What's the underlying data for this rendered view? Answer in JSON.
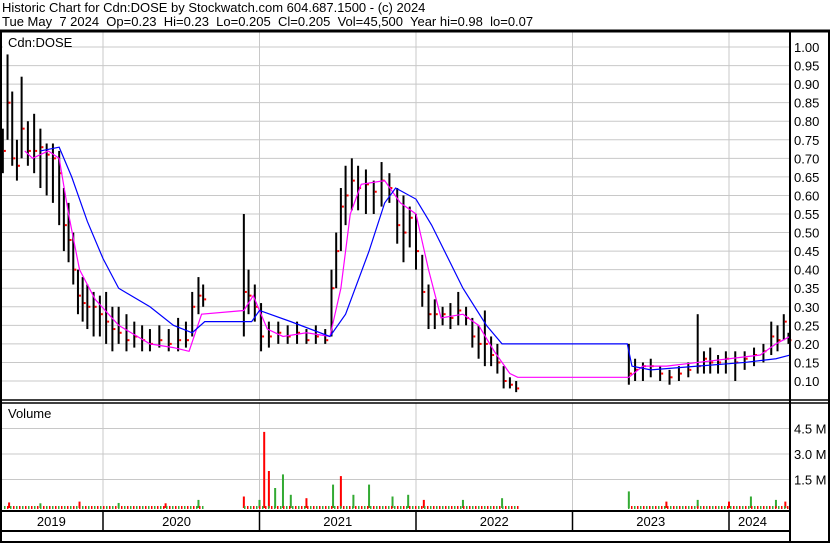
{
  "header": {
    "title": "Historic Chart for Cdn:DOSE by Stockwatch.com 604.687.1500 - (c) 2024",
    "quote": "Tue May  7 2024  Op=0.23  Hi=0.23  Lo=0.205  Cl=0.205  Vol=45,500  Year hi=0.98  lo=0.07"
  },
  "chart_data": {
    "type": "line",
    "title": "Cdn:DOSE",
    "volume_label": "Volume",
    "x_range": [
      2019.36,
      2024.39
    ],
    "ylim": [
      0.07,
      1.04
    ],
    "y_ticks": [
      "1.00",
      "0.95",
      "0.90",
      "0.85",
      "0.80",
      "0.75",
      "0.70",
      "0.65",
      "0.60",
      "0.55",
      "0.50",
      "0.45",
      "0.40",
      "0.35",
      "0.30",
      "0.25",
      "0.20",
      "0.15",
      "0.10"
    ],
    "y_tick_values": [
      1.0,
      0.95,
      0.9,
      0.85,
      0.8,
      0.75,
      0.7,
      0.65,
      0.6,
      0.55,
      0.5,
      0.45,
      0.4,
      0.35,
      0.3,
      0.25,
      0.2,
      0.15,
      0.1
    ],
    "volume_ticks": [
      "4.5 M",
      "3.0 M",
      "1.5 M"
    ],
    "volume_tick_values": [
      4.5,
      3.0,
      1.5
    ],
    "x_labels": [
      "2019",
      "2020",
      "2021",
      "2022",
      "2023",
      "2024"
    ],
    "x_label_positions": [
      2019.67,
      2020.47,
      2021.5,
      2022.5,
      2023.5,
      2024.15
    ],
    "year_boundaries": [
      2020,
      2021,
      2022,
      2023,
      2024
    ],
    "bars_hlc": [
      [
        2019.36,
        0.78,
        0.66,
        0.72
      ],
      [
        2019.39,
        0.98,
        0.75,
        0.85
      ],
      [
        2019.42,
        0.88,
        0.68,
        0.7
      ],
      [
        2019.45,
        0.75,
        0.64,
        0.68
      ],
      [
        2019.48,
        0.92,
        0.7,
        0.78
      ],
      [
        2019.52,
        0.8,
        0.68,
        0.72
      ],
      [
        2019.56,
        0.82,
        0.66,
        0.72
      ],
      [
        2019.6,
        0.78,
        0.62,
        0.73
      ],
      [
        2019.64,
        0.74,
        0.6,
        0.71
      ],
      [
        2019.68,
        0.74,
        0.58,
        0.7
      ],
      [
        2019.72,
        0.72,
        0.52,
        0.66
      ],
      [
        2019.75,
        0.62,
        0.45,
        0.52
      ],
      [
        2019.78,
        0.58,
        0.42,
        0.48
      ],
      [
        2019.81,
        0.5,
        0.36,
        0.4
      ],
      [
        2019.84,
        0.4,
        0.28,
        0.33
      ],
      [
        2019.87,
        0.38,
        0.26,
        0.31
      ],
      [
        2019.9,
        0.36,
        0.24,
        0.3
      ],
      [
        2019.94,
        0.34,
        0.22,
        0.3
      ],
      [
        2019.98,
        0.33,
        0.22,
        0.28
      ],
      [
        2020.02,
        0.34,
        0.2,
        0.26
      ],
      [
        2020.06,
        0.3,
        0.18,
        0.24
      ],
      [
        2020.1,
        0.3,
        0.2,
        0.23
      ],
      [
        2020.15,
        0.28,
        0.18,
        0.21
      ],
      [
        2020.2,
        0.26,
        0.19,
        0.22
      ],
      [
        2020.25,
        0.25,
        0.18,
        0.21
      ],
      [
        2020.3,
        0.24,
        0.18,
        0.2
      ],
      [
        2020.36,
        0.25,
        0.19,
        0.21
      ],
      [
        2020.42,
        0.24,
        0.18,
        0.2
      ],
      [
        2020.48,
        0.27,
        0.18,
        0.21
      ],
      [
        2020.53,
        0.26,
        0.19,
        0.21
      ],
      [
        2020.57,
        0.34,
        0.22,
        0.3
      ],
      [
        2020.61,
        0.38,
        0.28,
        0.33
      ],
      [
        2020.64,
        0.36,
        0.3,
        0.32
      ],
      [
        2020.9,
        0.55,
        0.22,
        0.34
      ],
      [
        2020.93,
        0.4,
        0.28,
        0.33
      ],
      [
        2020.97,
        0.36,
        0.26,
        0.3
      ],
      [
        2021.01,
        0.31,
        0.18,
        0.22
      ],
      [
        2021.06,
        0.26,
        0.19,
        0.22
      ],
      [
        2021.12,
        0.26,
        0.2,
        0.23
      ],
      [
        2021.18,
        0.25,
        0.2,
        0.22
      ],
      [
        2021.24,
        0.26,
        0.2,
        0.23
      ],
      [
        2021.3,
        0.24,
        0.2,
        0.21
      ],
      [
        2021.36,
        0.25,
        0.2,
        0.22
      ],
      [
        2021.42,
        0.24,
        0.2,
        0.21
      ],
      [
        2021.46,
        0.4,
        0.22,
        0.35
      ],
      [
        2021.49,
        0.5,
        0.35,
        0.45
      ],
      [
        2021.52,
        0.62,
        0.45,
        0.57
      ],
      [
        2021.55,
        0.68,
        0.52,
        0.6
      ],
      [
        2021.59,
        0.7,
        0.56,
        0.64
      ],
      [
        2021.63,
        0.68,
        0.56,
        0.62
      ],
      [
        2021.68,
        0.67,
        0.55,
        0.63
      ],
      [
        2021.73,
        0.64,
        0.55,
        0.61
      ],
      [
        2021.78,
        0.69,
        0.57,
        0.64
      ],
      [
        2021.83,
        0.66,
        0.58,
        0.62
      ],
      [
        2021.88,
        0.62,
        0.47,
        0.52
      ],
      [
        2021.92,
        0.6,
        0.42,
        0.5
      ],
      [
        2021.96,
        0.57,
        0.46,
        0.54
      ],
      [
        2022.0,
        0.55,
        0.4,
        0.45
      ],
      [
        2022.04,
        0.44,
        0.3,
        0.34
      ],
      [
        2022.08,
        0.36,
        0.24,
        0.28
      ],
      [
        2022.12,
        0.32,
        0.24,
        0.28
      ],
      [
        2022.17,
        0.3,
        0.25,
        0.28
      ],
      [
        2022.22,
        0.31,
        0.24,
        0.27
      ],
      [
        2022.27,
        0.34,
        0.25,
        0.29
      ],
      [
        2022.32,
        0.3,
        0.25,
        0.27
      ],
      [
        2022.36,
        0.27,
        0.19,
        0.22
      ],
      [
        2022.4,
        0.25,
        0.16,
        0.2
      ],
      [
        2022.44,
        0.29,
        0.14,
        0.2
      ],
      [
        2022.48,
        0.22,
        0.14,
        0.17
      ],
      [
        2022.52,
        0.2,
        0.12,
        0.15
      ],
      [
        2022.56,
        0.14,
        0.08,
        0.1
      ],
      [
        2022.6,
        0.11,
        0.08,
        0.09
      ],
      [
        2022.64,
        0.1,
        0.07,
        0.08
      ],
      [
        2023.36,
        0.2,
        0.09,
        0.12
      ],
      [
        2023.4,
        0.16,
        0.1,
        0.13
      ],
      [
        2023.45,
        0.15,
        0.1,
        0.14
      ],
      [
        2023.5,
        0.16,
        0.11,
        0.14
      ],
      [
        2023.56,
        0.14,
        0.1,
        0.12
      ],
      [
        2023.62,
        0.13,
        0.09,
        0.11
      ],
      [
        2023.68,
        0.14,
        0.1,
        0.12
      ],
      [
        2023.74,
        0.15,
        0.11,
        0.13
      ],
      [
        2023.8,
        0.28,
        0.12,
        0.14
      ],
      [
        2023.84,
        0.18,
        0.12,
        0.16
      ],
      [
        2023.88,
        0.19,
        0.12,
        0.15
      ],
      [
        2023.93,
        0.17,
        0.12,
        0.15
      ],
      [
        2023.98,
        0.18,
        0.12,
        0.16
      ],
      [
        2024.04,
        0.18,
        0.1,
        0.15
      ],
      [
        2024.1,
        0.18,
        0.13,
        0.16
      ],
      [
        2024.16,
        0.19,
        0.14,
        0.17
      ],
      [
        2024.22,
        0.2,
        0.15,
        0.18
      ],
      [
        2024.27,
        0.26,
        0.17,
        0.22
      ],
      [
        2024.31,
        0.25,
        0.18,
        0.21
      ],
      [
        2024.35,
        0.28,
        0.21,
        0.26
      ],
      [
        2024.38,
        0.23,
        0.2,
        0.21
      ]
    ],
    "series": [
      {
        "name": "short moving average",
        "color": "#ff00ff",
        "points": [
          [
            2019.5,
            0.72
          ],
          [
            2019.55,
            0.7
          ],
          [
            2019.65,
            0.72
          ],
          [
            2019.72,
            0.7
          ],
          [
            2019.78,
            0.55
          ],
          [
            2019.85,
            0.4
          ],
          [
            2019.95,
            0.32
          ],
          [
            2020.1,
            0.25
          ],
          [
            2020.3,
            0.2
          ],
          [
            2020.45,
            0.19
          ],
          [
            2020.55,
            0.18
          ],
          [
            2020.63,
            0.28
          ],
          [
            2020.9,
            0.29
          ],
          [
            2020.96,
            0.33
          ],
          [
            2021.05,
            0.24
          ],
          [
            2021.15,
            0.22
          ],
          [
            2021.3,
            0.23
          ],
          [
            2021.45,
            0.22
          ],
          [
            2021.52,
            0.35
          ],
          [
            2021.58,
            0.55
          ],
          [
            2021.65,
            0.63
          ],
          [
            2021.8,
            0.64
          ],
          [
            2021.9,
            0.58
          ],
          [
            2022.0,
            0.55
          ],
          [
            2022.08,
            0.4
          ],
          [
            2022.16,
            0.27
          ],
          [
            2022.3,
            0.28
          ],
          [
            2022.4,
            0.25
          ],
          [
            2022.5,
            0.18
          ],
          [
            2022.6,
            0.12
          ],
          [
            2022.65,
            0.11
          ],
          [
            2023.36,
            0.11
          ],
          [
            2023.45,
            0.14
          ],
          [
            2023.6,
            0.14
          ],
          [
            2023.8,
            0.15
          ],
          [
            2024.0,
            0.16
          ],
          [
            2024.2,
            0.17
          ],
          [
            2024.3,
            0.2
          ],
          [
            2024.39,
            0.22
          ]
        ]
      },
      {
        "name": "long moving average",
        "color": "#0000ff",
        "points": [
          [
            2019.6,
            0.72
          ],
          [
            2019.72,
            0.73
          ],
          [
            2019.8,
            0.65
          ],
          [
            2019.9,
            0.53
          ],
          [
            2020.0,
            0.43
          ],
          [
            2020.1,
            0.35
          ],
          [
            2020.3,
            0.3
          ],
          [
            2020.45,
            0.25
          ],
          [
            2020.57,
            0.23
          ],
          [
            2020.65,
            0.26
          ],
          [
            2020.95,
            0.26
          ],
          [
            2021.0,
            0.29
          ],
          [
            2021.2,
            0.26
          ],
          [
            2021.45,
            0.22
          ],
          [
            2021.55,
            0.28
          ],
          [
            2021.7,
            0.45
          ],
          [
            2021.8,
            0.58
          ],
          [
            2021.87,
            0.62
          ],
          [
            2022.0,
            0.59
          ],
          [
            2022.1,
            0.52
          ],
          [
            2022.3,
            0.35
          ],
          [
            2022.45,
            0.25
          ],
          [
            2022.55,
            0.2
          ],
          [
            2022.65,
            0.2
          ],
          [
            2023.35,
            0.2
          ],
          [
            2023.38,
            0.14
          ],
          [
            2023.5,
            0.13
          ],
          [
            2023.8,
            0.14
          ],
          [
            2024.1,
            0.15
          ],
          [
            2024.3,
            0.16
          ],
          [
            2024.39,
            0.17
          ]
        ]
      }
    ],
    "volume_millions": [
      [
        2019.4,
        0.15,
        "red"
      ],
      [
        2019.6,
        0.1,
        "green"
      ],
      [
        2019.85,
        0.2,
        "red"
      ],
      [
        2020.1,
        0.12,
        "green"
      ],
      [
        2020.4,
        0.1,
        "red"
      ],
      [
        2020.61,
        0.3,
        "green"
      ],
      [
        2020.9,
        0.5,
        "red"
      ],
      [
        2021.0,
        0.3,
        "green"
      ],
      [
        2021.03,
        4.3,
        "red"
      ],
      [
        2021.06,
        2.0,
        "red"
      ],
      [
        2021.1,
        1.0,
        "green"
      ],
      [
        2021.15,
        1.8,
        "green"
      ],
      [
        2021.2,
        0.6,
        "green"
      ],
      [
        2021.3,
        0.4,
        "red"
      ],
      [
        2021.47,
        1.2,
        "green"
      ],
      [
        2021.52,
        1.7,
        "red"
      ],
      [
        2021.6,
        0.6,
        "green"
      ],
      [
        2021.7,
        1.2,
        "green"
      ],
      [
        2021.85,
        0.5,
        "green"
      ],
      [
        2021.95,
        0.6,
        "green"
      ],
      [
        2022.05,
        0.3,
        "red"
      ],
      [
        2022.3,
        0.3,
        "green"
      ],
      [
        2022.55,
        0.4,
        "green"
      ],
      [
        2023.36,
        0.8,
        "green"
      ],
      [
        2023.6,
        0.2,
        "red"
      ],
      [
        2023.8,
        0.3,
        "green"
      ],
      [
        2024.0,
        0.2,
        "red"
      ],
      [
        2024.14,
        0.5,
        "green"
      ],
      [
        2024.3,
        0.3,
        "green"
      ],
      [
        2024.36,
        0.2,
        "red"
      ]
    ]
  }
}
